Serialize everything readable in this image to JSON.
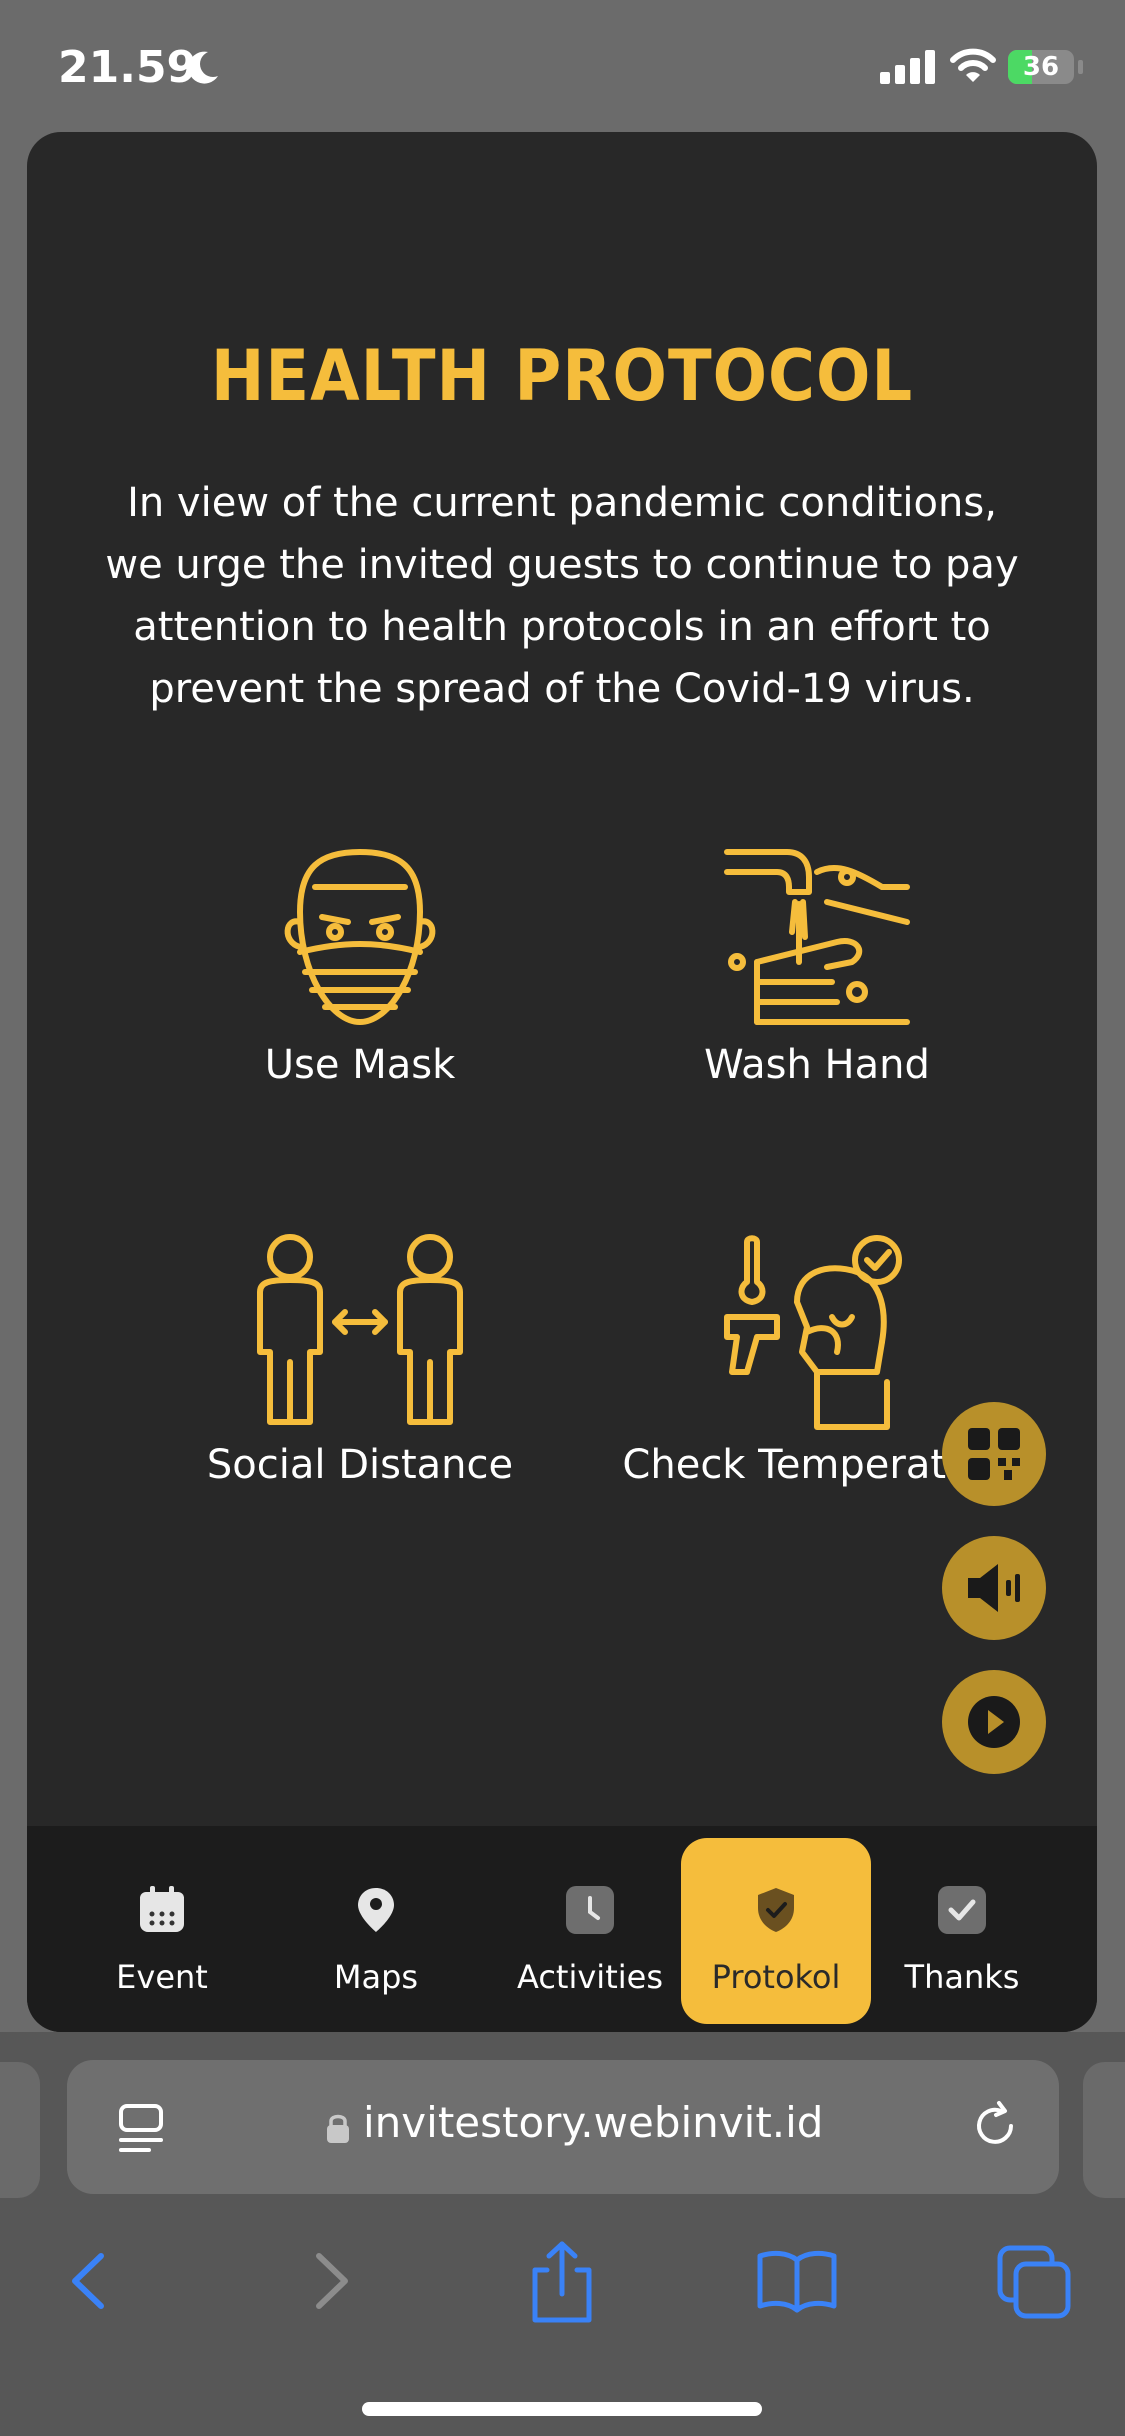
{
  "status": {
    "time": "21.59",
    "battery": "36",
    "battery_level": 0.36
  },
  "section": {
    "title": "HEALTH PROTOCOL",
    "intro": "In view of the current pandemic conditions, we urge the invited guests to continue to pay attention to health protocols in an effort to prevent the spread of the Covid-19 virus.",
    "items": [
      {
        "label": "Use Mask",
        "icon": "mask-icon"
      },
      {
        "label": "Wash Hand",
        "icon": "wash-hand-icon"
      },
      {
        "label": "Social Distance",
        "icon": "social-distance-icon"
      },
      {
        "label": "Check Temperature",
        "icon": "thermometer-icon"
      }
    ]
  },
  "fabs": [
    {
      "icon": "qr-code-icon"
    },
    {
      "icon": "speaker-icon"
    },
    {
      "icon": "play-icon"
    }
  ],
  "tabs": [
    {
      "label": "Event",
      "icon": "calendar-icon",
      "active": false
    },
    {
      "label": "Maps",
      "icon": "map-pin-icon",
      "active": false
    },
    {
      "label": "Activities",
      "icon": "clock-icon",
      "active": false
    },
    {
      "label": "Protokol",
      "icon": "shield-check-icon",
      "active": true
    },
    {
      "label": "Thanks",
      "icon": "check-icon",
      "active": false
    }
  ],
  "browser": {
    "url": "invitestory.webinvit.id",
    "toolbar": [
      "back-icon",
      "forward-icon",
      "share-icon",
      "bookmarks-icon",
      "tabs-icon"
    ]
  },
  "colors": {
    "accent": "#f5bd3c",
    "card": "#282828",
    "tabbar": "#1c1c1c",
    "fab": "#b8902a",
    "link_blue": "#3a82f7"
  }
}
